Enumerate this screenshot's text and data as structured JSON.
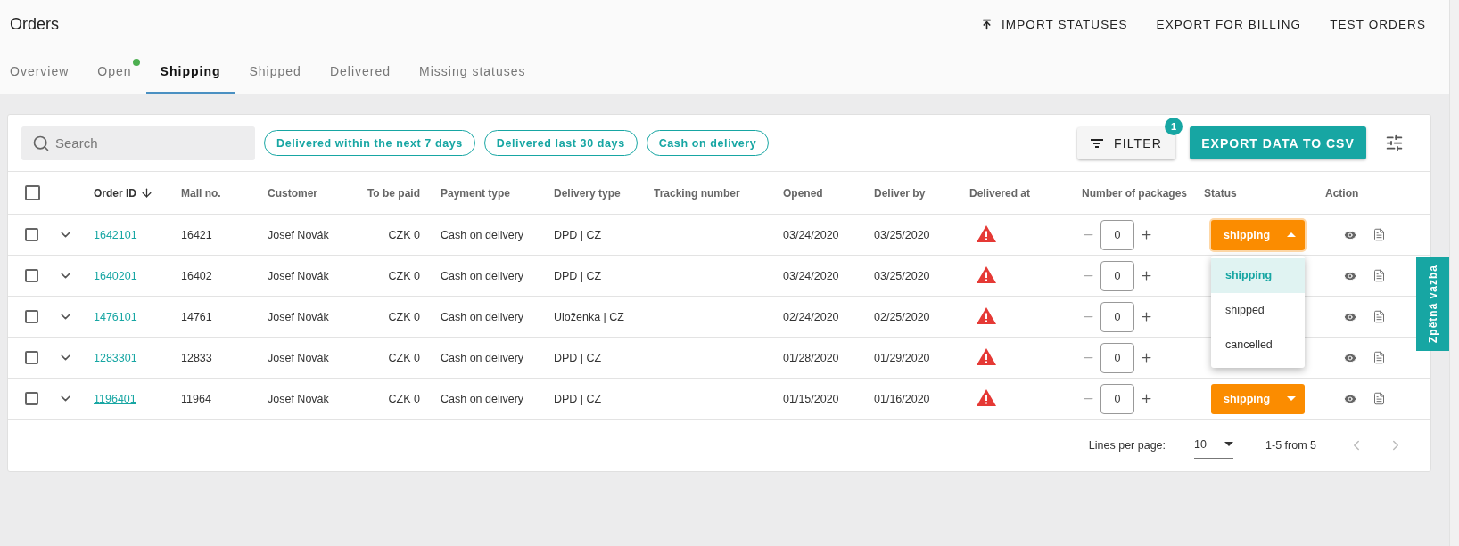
{
  "page": {
    "title": "Orders"
  },
  "header_actions": [
    {
      "label": "IMPORT STATUSES",
      "kind": "upload"
    },
    {
      "label": "EXPORT FOR BILLING",
      "kind": "plain"
    },
    {
      "label": "TEST ORDERS",
      "kind": "plain"
    }
  ],
  "tabs": [
    {
      "label": "Overview",
      "selected": false,
      "notification": false
    },
    {
      "label": "Open",
      "selected": false,
      "notification": true
    },
    {
      "label": "Shipping",
      "selected": true,
      "notification": false
    },
    {
      "label": "Shipped",
      "selected": false,
      "notification": false
    },
    {
      "label": "Delivered",
      "selected": false,
      "notification": false
    },
    {
      "label": "Missing statuses",
      "selected": false,
      "notification": false
    }
  ],
  "search": {
    "placeholder": "Search"
  },
  "quick_filters": [
    {
      "label": "Delivered within the next 7 days"
    },
    {
      "label": "Delivered last 30 days"
    },
    {
      "label": "Cash on delivery"
    }
  ],
  "filter_button": {
    "label": "FILTER",
    "badge": "1"
  },
  "export_button": {
    "label": "EXPORT DATA TO CSV"
  },
  "table": {
    "select_all": {
      "checked": false
    },
    "columns": [
      {
        "label": "Order ID",
        "sorted": true
      },
      {
        "label": "Mall no.",
        "sorted": false
      },
      {
        "label": "Customer",
        "sorted": false
      },
      {
        "label": "To be paid",
        "sorted": false
      },
      {
        "label": "Payment type",
        "sorted": false
      },
      {
        "label": "Delivery type",
        "sorted": false
      },
      {
        "label": "Tracking number",
        "sorted": false
      },
      {
        "label": "Opened",
        "sorted": false
      },
      {
        "label": "Deliver by",
        "sorted": false
      },
      {
        "label": "Delivered at",
        "sorted": false
      },
      {
        "label": "Number of packages",
        "sorted": false
      },
      {
        "label": "Status",
        "sorted": false
      },
      {
        "label": "Action",
        "sorted": false
      }
    ],
    "rows": [
      {
        "checked": false,
        "expanded": false,
        "order_id": "1642101",
        "mall_no": "16421",
        "customer": "Josef Novák",
        "to_be_paid": "CZK 0",
        "payment_type": "Cash on delivery",
        "delivery_type": "DPD | CZ",
        "opened": "03/24/2020",
        "deliver_by": "03/25/2020",
        "delivered_alert": true,
        "packages": "0",
        "status": "shipping",
        "status_open": true,
        "status_options": [
          {
            "label": "shipping",
            "selected": true
          },
          {
            "label": "shipped",
            "selected": false
          },
          {
            "label": "cancelled",
            "selected": false
          }
        ]
      },
      {
        "checked": false,
        "expanded": false,
        "order_id": "1640201",
        "mall_no": "16402",
        "customer": "Josef Novák",
        "to_be_paid": "CZK 0",
        "payment_type": "Cash on delivery",
        "delivery_type": "DPD | CZ",
        "opened": "03/24/2020",
        "deliver_by": "03/25/2020",
        "delivered_alert": true,
        "packages": "0"
      },
      {
        "checked": false,
        "expanded": false,
        "order_id": "1476101",
        "mall_no": "14761",
        "customer": "Josef Novák",
        "to_be_paid": "CZK 0",
        "payment_type": "Cash on delivery",
        "delivery_type": "Uloženka | CZ",
        "opened": "02/24/2020",
        "deliver_by": "02/25/2020",
        "delivered_alert": true,
        "packages": "0"
      },
      {
        "checked": false,
        "expanded": false,
        "order_id": "1283301",
        "mall_no": "12833",
        "customer": "Josef Novák",
        "to_be_paid": "CZK 0",
        "payment_type": "Cash on delivery",
        "delivery_type": "DPD | CZ",
        "opened": "01/28/2020",
        "deliver_by": "01/29/2020",
        "delivered_alert": true,
        "packages": "0"
      },
      {
        "checked": false,
        "expanded": false,
        "order_id": "1196401",
        "mall_no": "11964",
        "customer": "Josef Novák",
        "to_be_paid": "CZK 0",
        "payment_type": "Cash on delivery",
        "delivery_type": "DPD | CZ",
        "opened": "01/15/2020",
        "deliver_by": "01/16/2020",
        "delivered_alert": true,
        "packages": "0",
        "status": "shipping",
        "status_open": false
      }
    ]
  },
  "pagination": {
    "lines_label": "Lines per page:",
    "lines_value": "10",
    "range": "1-5 from 5"
  },
  "feedback_tab": {
    "label": "Zpětná vazba"
  }
}
